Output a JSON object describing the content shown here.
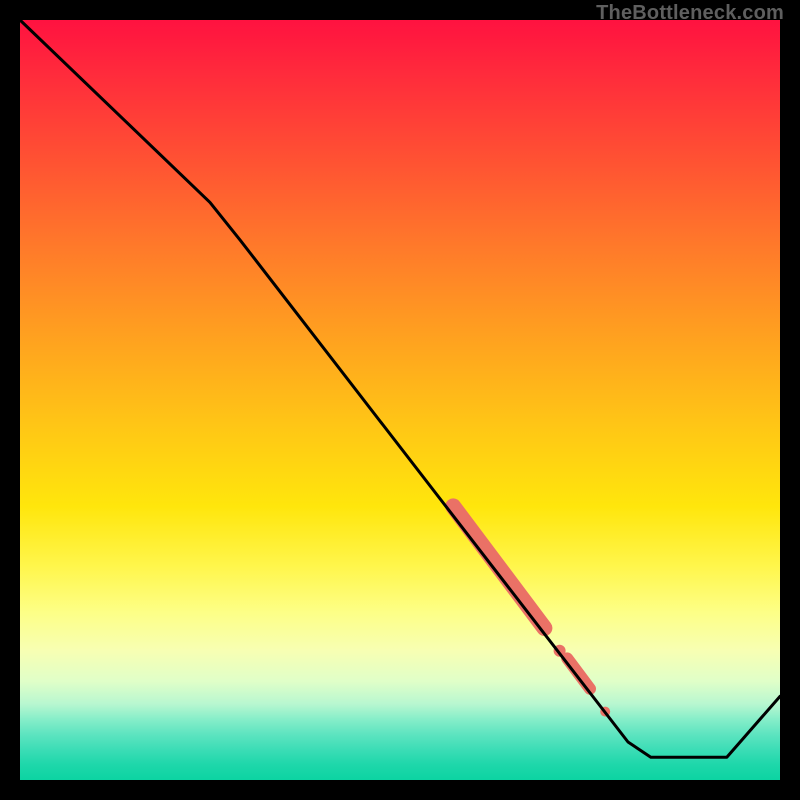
{
  "watermark": "TheBottleneck.com",
  "chart_data": {
    "type": "line",
    "title": "",
    "xlabel": "",
    "ylabel": "",
    "xlim": [
      0,
      100
    ],
    "ylim": [
      0,
      100
    ],
    "grid": false,
    "series": [
      {
        "name": "curve",
        "color": "#000000",
        "points": [
          {
            "x": 0,
            "y": 100
          },
          {
            "x": 25,
            "y": 76
          },
          {
            "x": 29,
            "y": 71
          },
          {
            "x": 80,
            "y": 5
          },
          {
            "x": 83,
            "y": 3
          },
          {
            "x": 93,
            "y": 3
          },
          {
            "x": 100,
            "y": 11
          }
        ]
      }
    ],
    "highlights": [
      {
        "name": "thick-segment",
        "color": "#ea7166",
        "type": "thick-line",
        "width": 16,
        "points": [
          {
            "x": 57,
            "y": 36
          },
          {
            "x": 69,
            "y": 20
          }
        ]
      },
      {
        "name": "gap-dot",
        "color": "#ea7166",
        "type": "dot",
        "r": 6,
        "point": {
          "x": 71,
          "y": 17
        }
      },
      {
        "name": "short-segment",
        "color": "#ea7166",
        "type": "thick-line",
        "width": 12,
        "points": [
          {
            "x": 72,
            "y": 16
          },
          {
            "x": 75,
            "y": 12
          }
        ]
      },
      {
        "name": "end-dot",
        "color": "#ea7166",
        "type": "dot",
        "r": 5,
        "point": {
          "x": 77,
          "y": 9
        }
      }
    ]
  }
}
